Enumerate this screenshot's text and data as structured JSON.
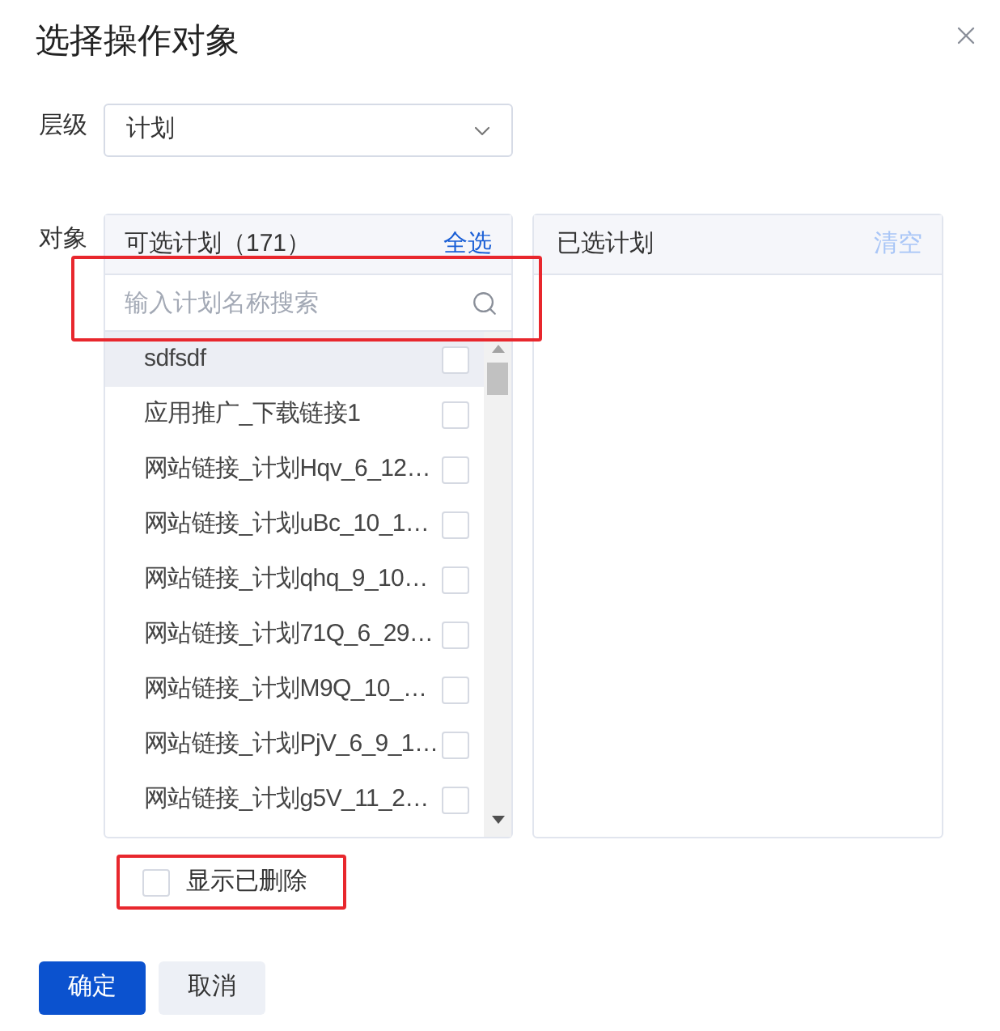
{
  "dialog": {
    "title": "选择操作对象"
  },
  "level_field": {
    "label": "层级",
    "value": "计划"
  },
  "object_field": {
    "label": "对象"
  },
  "available_panel": {
    "title": "可选计划（171）",
    "select_all": {
      "label": "全选",
      "disabled": false
    },
    "search": {
      "placeholder": "输入计划名称搜索",
      "highlighted": true
    },
    "items": [
      {
        "name": "sdfsdf",
        "hovered": true,
        "checked": false
      },
      {
        "name": "应用推广_下载链接1",
        "hovered": false,
        "checked": false
      },
      {
        "name": "网站链接_计划Hqv_6_12…",
        "hovered": false,
        "checked": false
      },
      {
        "name": "网站链接_计划uBc_10_1…",
        "hovered": false,
        "checked": false
      },
      {
        "name": "网站链接_计划qhq_9_10…",
        "hovered": false,
        "checked": false
      },
      {
        "name": "网站链接_计划71Q_6_29…",
        "hovered": false,
        "checked": false
      },
      {
        "name": "网站链接_计划M9Q_10_…",
        "hovered": false,
        "checked": false
      },
      {
        "name": "网站链接_计划PjV_6_9_1…",
        "hovered": false,
        "checked": false
      },
      {
        "name": "网站链接_计划g5V_11_2…",
        "hovered": false,
        "checked": false
      }
    ]
  },
  "selected_panel": {
    "title": "已选计划",
    "clear": {
      "label": "清空",
      "disabled": true
    }
  },
  "show_deleted": {
    "label": "显示已删除",
    "checked": false,
    "highlighted": true
  },
  "buttons": [
    {
      "label": "确定",
      "kind": "primary"
    },
    {
      "label": "取消",
      "kind": "secondary"
    }
  ]
}
